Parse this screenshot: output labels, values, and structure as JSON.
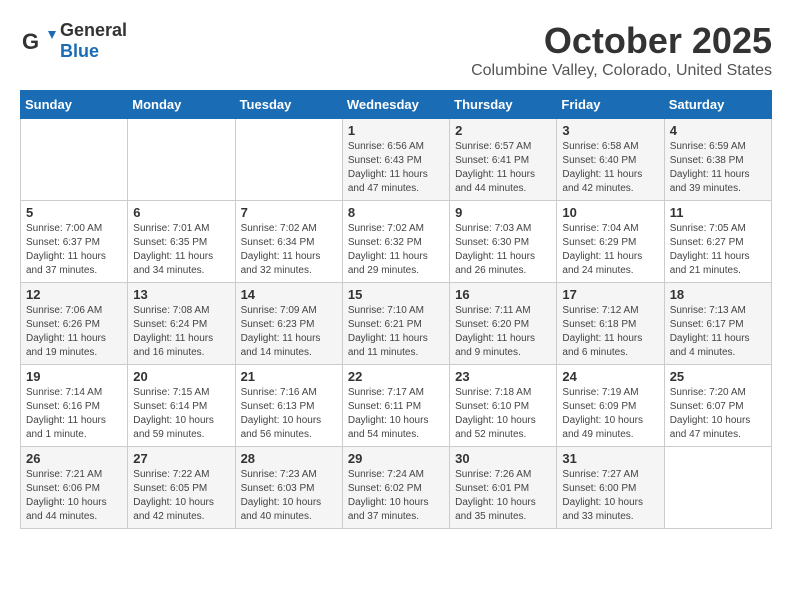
{
  "header": {
    "logo_general": "General",
    "logo_blue": "Blue",
    "month": "October 2025",
    "location": "Columbine Valley, Colorado, United States"
  },
  "weekdays": [
    "Sunday",
    "Monday",
    "Tuesday",
    "Wednesday",
    "Thursday",
    "Friday",
    "Saturday"
  ],
  "weeks": [
    [
      {
        "day": "",
        "info": ""
      },
      {
        "day": "",
        "info": ""
      },
      {
        "day": "",
        "info": ""
      },
      {
        "day": "1",
        "info": "Sunrise: 6:56 AM\nSunset: 6:43 PM\nDaylight: 11 hours and 47 minutes."
      },
      {
        "day": "2",
        "info": "Sunrise: 6:57 AM\nSunset: 6:41 PM\nDaylight: 11 hours and 44 minutes."
      },
      {
        "day": "3",
        "info": "Sunrise: 6:58 AM\nSunset: 6:40 PM\nDaylight: 11 hours and 42 minutes."
      },
      {
        "day": "4",
        "info": "Sunrise: 6:59 AM\nSunset: 6:38 PM\nDaylight: 11 hours and 39 minutes."
      }
    ],
    [
      {
        "day": "5",
        "info": "Sunrise: 7:00 AM\nSunset: 6:37 PM\nDaylight: 11 hours and 37 minutes."
      },
      {
        "day": "6",
        "info": "Sunrise: 7:01 AM\nSunset: 6:35 PM\nDaylight: 11 hours and 34 minutes."
      },
      {
        "day": "7",
        "info": "Sunrise: 7:02 AM\nSunset: 6:34 PM\nDaylight: 11 hours and 32 minutes."
      },
      {
        "day": "8",
        "info": "Sunrise: 7:02 AM\nSunset: 6:32 PM\nDaylight: 11 hours and 29 minutes."
      },
      {
        "day": "9",
        "info": "Sunrise: 7:03 AM\nSunset: 6:30 PM\nDaylight: 11 hours and 26 minutes."
      },
      {
        "day": "10",
        "info": "Sunrise: 7:04 AM\nSunset: 6:29 PM\nDaylight: 11 hours and 24 minutes."
      },
      {
        "day": "11",
        "info": "Sunrise: 7:05 AM\nSunset: 6:27 PM\nDaylight: 11 hours and 21 minutes."
      }
    ],
    [
      {
        "day": "12",
        "info": "Sunrise: 7:06 AM\nSunset: 6:26 PM\nDaylight: 11 hours and 19 minutes."
      },
      {
        "day": "13",
        "info": "Sunrise: 7:08 AM\nSunset: 6:24 PM\nDaylight: 11 hours and 16 minutes."
      },
      {
        "day": "14",
        "info": "Sunrise: 7:09 AM\nSunset: 6:23 PM\nDaylight: 11 hours and 14 minutes."
      },
      {
        "day": "15",
        "info": "Sunrise: 7:10 AM\nSunset: 6:21 PM\nDaylight: 11 hours and 11 minutes."
      },
      {
        "day": "16",
        "info": "Sunrise: 7:11 AM\nSunset: 6:20 PM\nDaylight: 11 hours and 9 minutes."
      },
      {
        "day": "17",
        "info": "Sunrise: 7:12 AM\nSunset: 6:18 PM\nDaylight: 11 hours and 6 minutes."
      },
      {
        "day": "18",
        "info": "Sunrise: 7:13 AM\nSunset: 6:17 PM\nDaylight: 11 hours and 4 minutes."
      }
    ],
    [
      {
        "day": "19",
        "info": "Sunrise: 7:14 AM\nSunset: 6:16 PM\nDaylight: 11 hours and 1 minute."
      },
      {
        "day": "20",
        "info": "Sunrise: 7:15 AM\nSunset: 6:14 PM\nDaylight: 10 hours and 59 minutes."
      },
      {
        "day": "21",
        "info": "Sunrise: 7:16 AM\nSunset: 6:13 PM\nDaylight: 10 hours and 56 minutes."
      },
      {
        "day": "22",
        "info": "Sunrise: 7:17 AM\nSunset: 6:11 PM\nDaylight: 10 hours and 54 minutes."
      },
      {
        "day": "23",
        "info": "Sunrise: 7:18 AM\nSunset: 6:10 PM\nDaylight: 10 hours and 52 minutes."
      },
      {
        "day": "24",
        "info": "Sunrise: 7:19 AM\nSunset: 6:09 PM\nDaylight: 10 hours and 49 minutes."
      },
      {
        "day": "25",
        "info": "Sunrise: 7:20 AM\nSunset: 6:07 PM\nDaylight: 10 hours and 47 minutes."
      }
    ],
    [
      {
        "day": "26",
        "info": "Sunrise: 7:21 AM\nSunset: 6:06 PM\nDaylight: 10 hours and 44 minutes."
      },
      {
        "day": "27",
        "info": "Sunrise: 7:22 AM\nSunset: 6:05 PM\nDaylight: 10 hours and 42 minutes."
      },
      {
        "day": "28",
        "info": "Sunrise: 7:23 AM\nSunset: 6:03 PM\nDaylight: 10 hours and 40 minutes."
      },
      {
        "day": "29",
        "info": "Sunrise: 7:24 AM\nSunset: 6:02 PM\nDaylight: 10 hours and 37 minutes."
      },
      {
        "day": "30",
        "info": "Sunrise: 7:26 AM\nSunset: 6:01 PM\nDaylight: 10 hours and 35 minutes."
      },
      {
        "day": "31",
        "info": "Sunrise: 7:27 AM\nSunset: 6:00 PM\nDaylight: 10 hours and 33 minutes."
      },
      {
        "day": "",
        "info": ""
      }
    ]
  ]
}
